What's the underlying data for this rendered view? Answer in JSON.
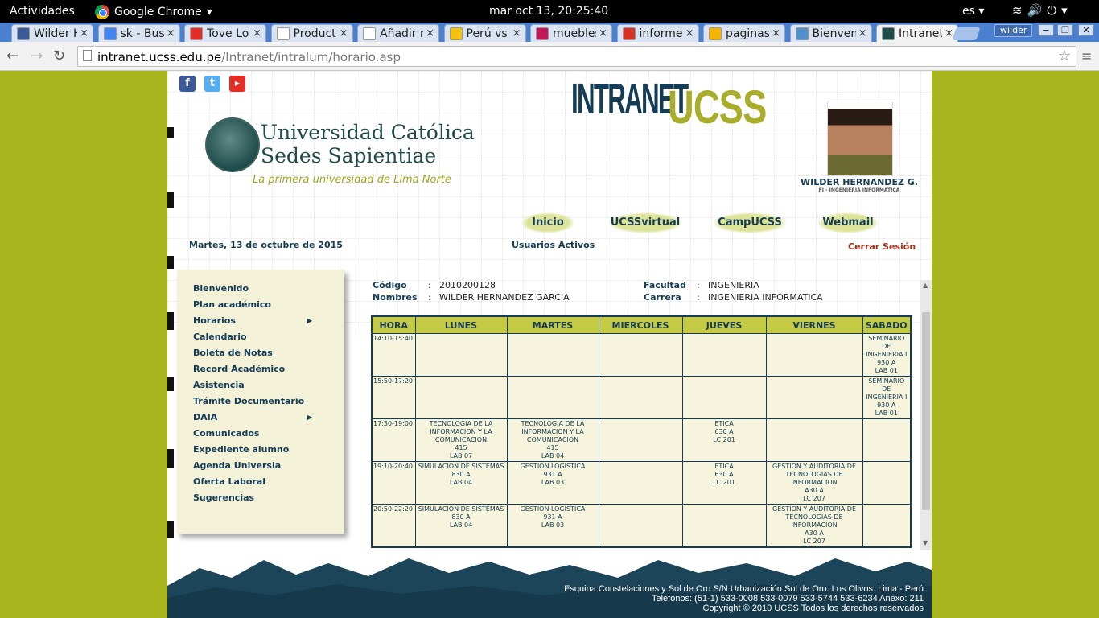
{
  "os_bar": {
    "activities": "Actividades",
    "app_name": "Google Chrome",
    "clock": "mar oct 13, 20:25:40",
    "lang": "es"
  },
  "tabs": [
    {
      "label": "Wilder H",
      "icon": "facebook-icon",
      "color": "#3b5998"
    },
    {
      "label": "sk - Bus",
      "icon": "google-icon",
      "color": "#4285f4"
    },
    {
      "label": "Tove Lo",
      "icon": "youtube-icon",
      "color": "#e52d27"
    },
    {
      "label": "Product",
      "icon": "page-icon",
      "color": "#ffffff"
    },
    {
      "label": "Añadir n",
      "icon": "page-icon",
      "color": "#ffffff"
    },
    {
      "label": "Perú vs",
      "icon": "site-icon",
      "color": "#f4c20d"
    },
    {
      "label": "muebles",
      "icon": "site-icon",
      "color": "#c2185b"
    },
    {
      "label": "informe",
      "icon": "gmail-icon",
      "color": "#d93025"
    },
    {
      "label": "paginas",
      "icon": "site-icon",
      "color": "#f6b400"
    },
    {
      "label": "Bienven",
      "icon": "joomla-icon",
      "color": "#5091cd"
    },
    {
      "label": "Intranet",
      "icon": "ucss-icon",
      "color": "#1f4b4a"
    }
  ],
  "browser": {
    "user": "wilder",
    "url_host": "intranet.ucss.edu.pe",
    "url_path": "/Intranet/intralum/horario.asp"
  },
  "header": {
    "brand_part1": "INTRANET",
    "brand_part2": "UCSS",
    "uni_line1": "Universidad Católica",
    "uni_line2": "Sedes Sapientiae",
    "tagline": "La primera universidad de Lima Norte",
    "user_name": "WILDER HERNANDEZ G.",
    "user_career": "FI - INGENIERIA INFORMATICA",
    "date": "Martes, 13 de octubre de 2015",
    "active_users": "Usuarios Activos",
    "logout": "Cerrar Sesión"
  },
  "nav": [
    "Inicio",
    "UCSSvirtual",
    "CampUCSS",
    "Webmail"
  ],
  "sidebar": [
    {
      "label": "Bienvenido",
      "sub": false
    },
    {
      "label": "Plan académico",
      "sub": false
    },
    {
      "label": "Horarios",
      "sub": true
    },
    {
      "label": "Calendario",
      "sub": false
    },
    {
      "label": "Boleta de Notas",
      "sub": false
    },
    {
      "label": "Record Académico",
      "sub": false
    },
    {
      "label": "Asistencia",
      "sub": false
    },
    {
      "label": "Trámite Documentario",
      "sub": false
    },
    {
      "label": "DAIA",
      "sub": true
    },
    {
      "label": "Comunicados",
      "sub": false
    },
    {
      "label": "Expediente alumno",
      "sub": false
    },
    {
      "label": "Agenda Universia",
      "sub": false
    },
    {
      "label": "Oferta Laboral",
      "sub": false
    },
    {
      "label": "Sugerencias",
      "sub": false
    }
  ],
  "student": {
    "codigo_label": "Código",
    "codigo": "2010200128",
    "nombres_label": "Nombres",
    "nombres": "WILDER HERNANDEZ GARCIA",
    "facultad_label": "Facultad",
    "facultad": "INGENIERIA",
    "carrera_label": "Carrera",
    "carrera": "INGENIERIA INFORMATICA",
    "sep": ":"
  },
  "schedule": {
    "headers": [
      "HORA",
      "LUNES",
      "MARTES",
      "MIERCOLES",
      "JUEVES",
      "VIERNES",
      "SABADO"
    ],
    "rows": [
      {
        "hora": "14:10-15:40",
        "cells": [
          [],
          [],
          [],
          [],
          [],
          [
            "SEMINARIO DE INGENIERIA I",
            "930 A",
            "LAB 01"
          ]
        ]
      },
      {
        "hora": "15:50-17:20",
        "cells": [
          [],
          [],
          [],
          [],
          [],
          [
            "SEMINARIO DE INGENIERIA I",
            "930 A",
            "LAB 01"
          ]
        ]
      },
      {
        "hora": "17:30-19:00",
        "cells": [
          [
            "TECNOLOGIA DE LA INFORMACION Y LA COMUNICACION",
            "415",
            "LAB 07"
          ],
          [
            "TECNOLOGIA DE LA INFORMACION Y LA COMUNICACION",
            "415",
            "LAB 04"
          ],
          [],
          [
            "ETICA",
            "630 A",
            "LC 201"
          ],
          [],
          []
        ]
      },
      {
        "hora": "19:10-20:40",
        "cells": [
          [
            "SIMULACION DE SISTEMAS",
            "830 A",
            "LAB 04"
          ],
          [
            "GESTION LOGISTICA",
            "931 A",
            "LAB 03"
          ],
          [],
          [
            "ETICA",
            "630 A",
            "LC 201"
          ],
          [
            "GESTION Y AUDITORIA DE TECNOLOGIAS DE INFORMACION",
            "A30 A",
            "LC 207"
          ],
          []
        ]
      },
      {
        "hora": "20:50-22:20",
        "cells": [
          [
            "SIMULACION DE SISTEMAS",
            "830 A",
            "LAB 04"
          ],
          [
            "GESTION LOGISTICA",
            "931 A",
            "LAB 03"
          ],
          [],
          [],
          [
            "GESTION Y AUDITORIA DE TECNOLOGIAS DE INFORMACION",
            "A30 A",
            "LC 207"
          ],
          []
        ]
      }
    ]
  },
  "footer": {
    "line1": "Esquina Constelaciones y Sol de Oro S/N Urbanización Sol de Oro. Los Olivos. Lima - Perú",
    "line2": "Teléfonos: (51-1) 533-0008  533-0079  533-5744  533-6234  Anexo: 211",
    "line3": "Copyright © 2010 UCSS Todos los derechos reservados"
  },
  "colors": {
    "navy": "#153c55",
    "olive": "#a9ad2a",
    "page_bg": "#a9b51f",
    "logout": "#a5331c"
  }
}
